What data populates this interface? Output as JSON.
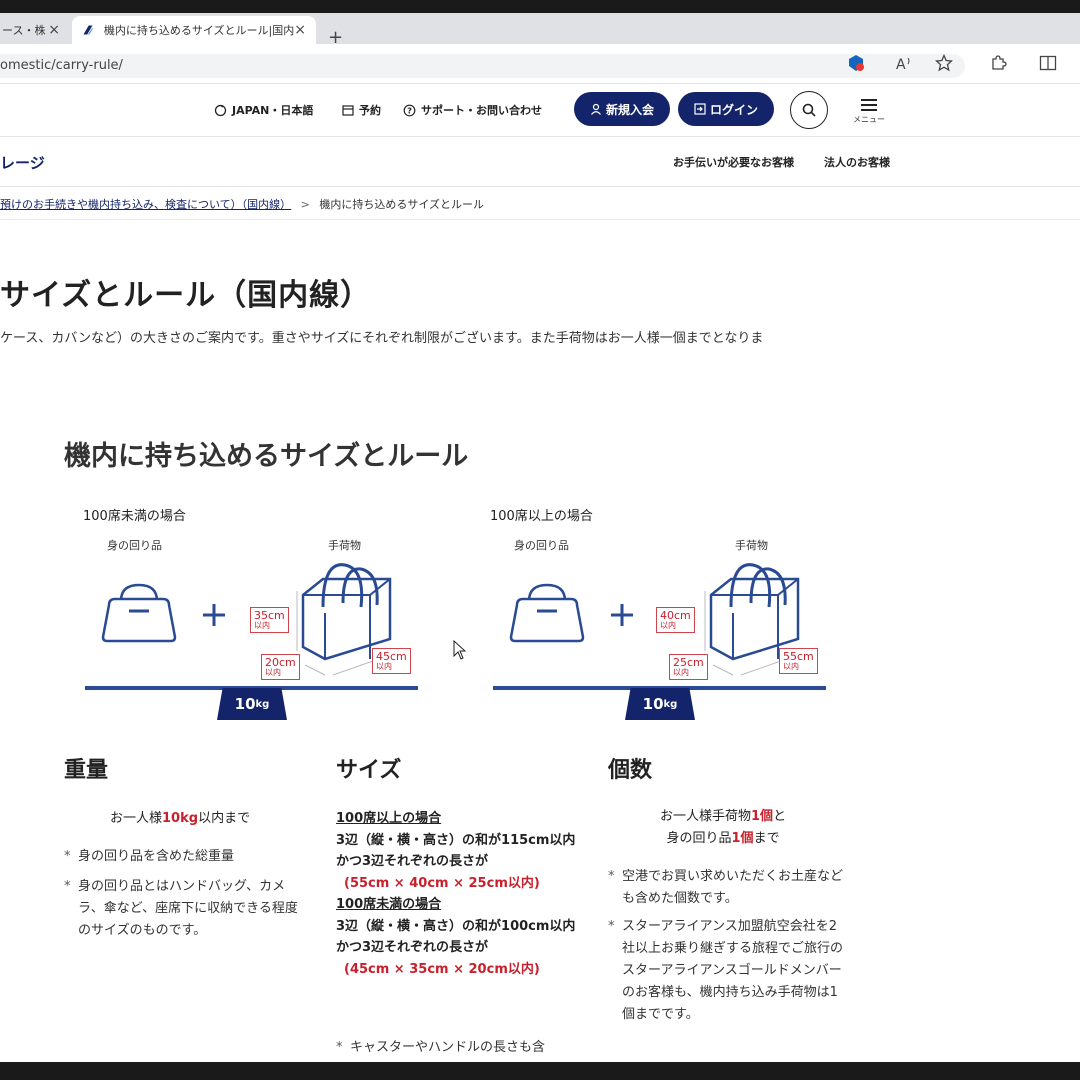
{
  "browser": {
    "tab1_title": "ース・株",
    "tab2_title": "機内に持ち込めるサイズとルール|国内",
    "tab_close": "×",
    "new_tab": "+",
    "url": "omestic/carry-rule/"
  },
  "header": {
    "language": "JAPAN・日本語",
    "reserve": "予約",
    "support": "サポート・お問い合わせ",
    "signup": "新規入会",
    "login": "ログイン",
    "menu": "メニュー",
    "brand": "レージ",
    "assist_link": "お手伝いが必要なお客様",
    "corporate_link": "法人のお客様"
  },
  "breadcrumb": {
    "parent": "預けのお手続きや機内持ち込み、検査について）（国内線）",
    "separator": ">",
    "current": "機内に持ち込めるサイズとルール"
  },
  "page": {
    "title": "サイズとルール（国内線）",
    "intro": "ケース、カバンなど）の大きさのご案内です。重さやサイズにそれぞれ制限がございます。また手荷物はお一人様一個までとなりま"
  },
  "section": {
    "title": "機内に持ち込めるサイズとルール"
  },
  "cases": [
    {
      "label": "100席未満の場合",
      "personal_label": "身の回り品",
      "baggage_label": "手荷物",
      "height": "35cm",
      "depth": "20cm",
      "width": "45cm",
      "limit_unit": "以内",
      "weight": "10",
      "weight_unit": "kg"
    },
    {
      "label": "100席以上の場合",
      "personal_label": "身の回り品",
      "baggage_label": "手荷物",
      "height": "40cm",
      "depth": "25cm",
      "width": "55cm",
      "limit_unit": "以内",
      "weight": "10",
      "weight_unit": "kg"
    }
  ],
  "weight_col": {
    "title": "重量",
    "lead_pre": "お一人様",
    "lead_red": "10kg",
    "lead_post": "以内まで",
    "note1": "身の回り品を含めた総重量",
    "note2": "身の回り品とはハンドバッグ、カメラ、傘など、座席下に収納できる程度のサイズのものです。"
  },
  "size_col": {
    "title": "サイズ",
    "a_head": "100席以上の場合",
    "a_rule": "3辺（縦・横・高さ）の和が115cm以内",
    "a_each": "かつ3辺それぞれの長さが",
    "a_dims": "(55cm × 40cm × 25cm以内)",
    "b_head": "100席未満の場合",
    "b_rule": "3辺（縦・横・高さ）の和が100cm以内",
    "b_each": "かつ3辺それぞれの長さが",
    "b_dims": "(45cm × 35cm × 20cm以内)",
    "note1": "キャスターやハンドルの長さも含"
  },
  "count_col": {
    "title": "個数",
    "l1_pre": "お一人様手荷物",
    "l1_red": "1個",
    "l1_post": "と",
    "l2_pre": "身の回り品",
    "l2_red": "1個",
    "l2_post": "まで",
    "note1": "空港でお買い求めいただくお土産なども含めた個数です。",
    "note2": "スターアライアンス加盟航空会社を2社以上お乗り継ぎする旅程でご旅行のスターアライアンスゴールドメンバーのお客様も、機内持ち込み手荷物は1個までです。"
  },
  "colors": {
    "navy": "#13246a",
    "accent_red": "#c8202c",
    "bag_blue": "#2a4a94"
  }
}
